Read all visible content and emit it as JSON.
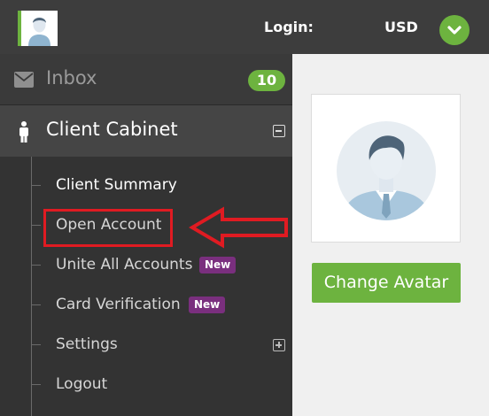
{
  "header": {
    "login_label": "Login:",
    "currency": "USD",
    "accent_color": "#6db33f"
  },
  "sidebar": {
    "inbox": {
      "label": "Inbox",
      "count": "10",
      "icon": "envelope-icon"
    },
    "client_cabinet": {
      "label": "Client Cabinet",
      "icon": "person-icon"
    },
    "items": [
      {
        "label": "Client Summary"
      },
      {
        "label": "Open Account"
      },
      {
        "label": "Unite All Accounts",
        "badge": "New"
      },
      {
        "label": "Card Verification",
        "badge": "New"
      },
      {
        "label": "Settings"
      },
      {
        "label": "Logout"
      }
    ],
    "badge_color": "#7a2f7e",
    "highlight_color": "#e01b22"
  },
  "profile": {
    "change_avatar_label": "Change Avatar"
  }
}
